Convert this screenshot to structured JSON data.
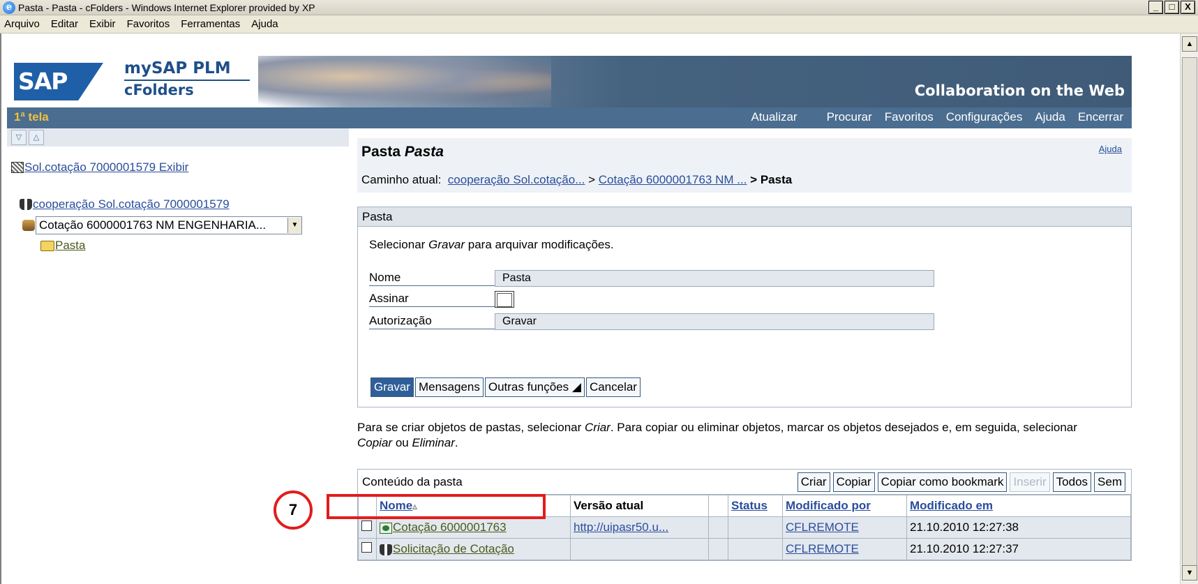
{
  "window": {
    "title": "Pasta - Pasta - cFolders - Windows Internet Explorer provided by XP",
    "controls": [
      "_",
      "□",
      "X"
    ]
  },
  "menu": [
    "Arquivo",
    "Editar",
    "Exibir",
    "Favoritos",
    "Ferramentas",
    "Ajuda"
  ],
  "header": {
    "logo": "SAP",
    "product": "mySAP PLM",
    "module": "cFolders",
    "tagline": "Collaboration on the Web"
  },
  "nav": {
    "screen_title": "1ª tela",
    "links": [
      "Atualizar",
      "Procurar",
      "Favoritos",
      "Configurações",
      "Ajuda",
      "Encerrar"
    ]
  },
  "tree": {
    "item1": "Sol.cotação 7000001579 Exibir",
    "item2": "cooperação Sol.cotação 7000001579",
    "combo_value": "Cotação 6000001763 NM ENGENHARIA...",
    "item3": "Pasta"
  },
  "page": {
    "title_prefix": "Pasta",
    "title_name": "Pasta",
    "help": "Ajuda",
    "path_label": "Caminho atual:",
    "path_1": "cooperação Sol.cotação...",
    "path_sep": ">",
    "path_2": "Cotação 6000001763 NM ...",
    "path_current": "> Pasta"
  },
  "panel": {
    "title": "Pasta",
    "info_pre": "Selecionar ",
    "info_em": "Gravar",
    "info_post": " para arquivar modificações.",
    "fields": {
      "nome_label": "Nome",
      "nome_value": "Pasta",
      "assinar_label": "Assinar",
      "autorizacao_label": "Autorização",
      "autorizacao_value": "Gravar"
    },
    "buttons": {
      "gravar": "Gravar",
      "mensagens": "Mensagens",
      "outras": "Outras funções ◢",
      "cancelar": "Cancelar"
    }
  },
  "info2": {
    "p1": "Para se criar objetos de pastas, selecionar ",
    "e1": "Criar",
    "p2": ". Para copiar ou eliminar objetos, marcar os objetos desejados e, em seguida, selecionar ",
    "e2": "Copiar",
    "p3": " ou ",
    "e3": "Eliminar",
    "p4": "."
  },
  "table": {
    "title": "Conteúdo da pasta",
    "buttons": {
      "criar": "Criar",
      "copiar": "Copiar",
      "copiar_bookmark": "Copiar como bookmark",
      "inserir": "Inserir",
      "todos": "Todos",
      "sem": "Sem"
    },
    "columns": {
      "nome": "Nome",
      "sort_icon": "▵",
      "versao": "Versão atual",
      "status": "Status",
      "modificado_por": "Modificado por",
      "modificado_em": "Modificado em"
    },
    "rows": [
      {
        "nome": "Cotação 6000001763",
        "versao": "http://uipasr50.u...",
        "status": "",
        "modificado_por": "CFLREMOTE",
        "modificado_em": "21.10.2010 12:27:38"
      },
      {
        "nome": "Solicitação de Cotação",
        "versao": "",
        "status": "",
        "modificado_por": "CFLREMOTE",
        "modificado_em": "21.10.2010 12:27:37"
      }
    ]
  },
  "annotation": {
    "step": "7",
    "color": "#e21c1c"
  }
}
